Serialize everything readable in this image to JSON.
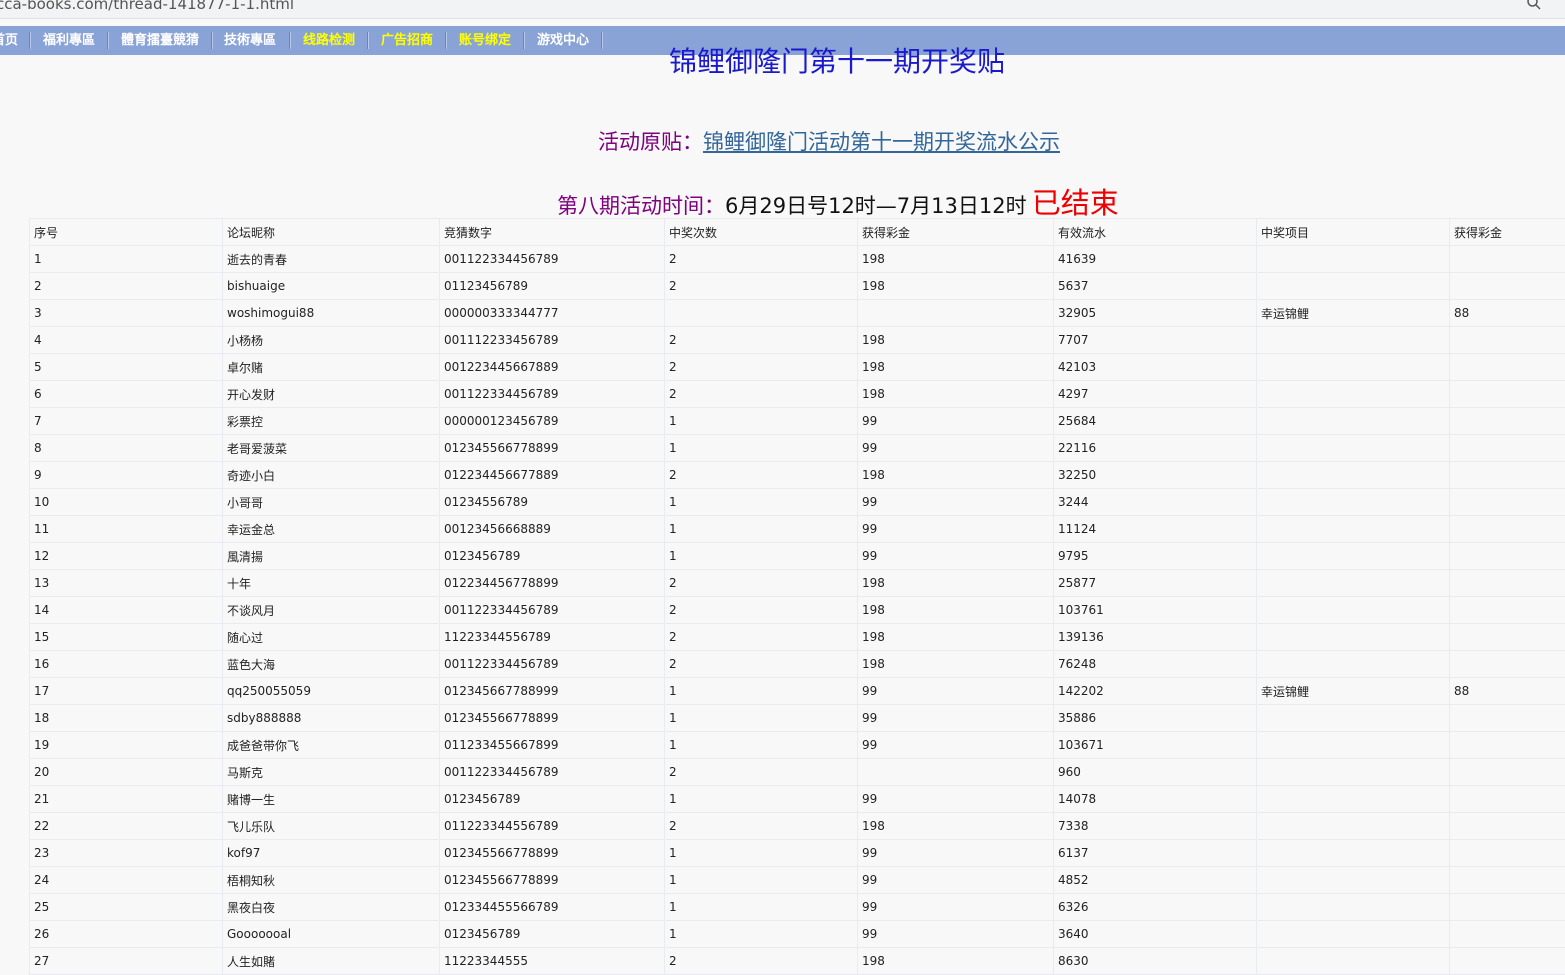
{
  "browser": {
    "url": "cca-books.com/thread-141877-1-1.html"
  },
  "nav": {
    "items": [
      {
        "label": "首页",
        "color": "#ffffff"
      },
      {
        "label": "福利專區",
        "color": "#ffffff"
      },
      {
        "label": "體育擂臺競猜",
        "color": "#ffffff"
      },
      {
        "label": "技術專區",
        "color": "#ffffff"
      },
      {
        "label": "线路检测",
        "color": "#ffff00"
      },
      {
        "label": "广告招商",
        "color": "#ffff00"
      },
      {
        "label": "账号绑定",
        "color": "#ffff00"
      },
      {
        "label": "游戏中心",
        "color": "#ffffff"
      }
    ]
  },
  "page": {
    "title": "锦鲤御隆门第十一期开奖贴",
    "original_post_label": "活动原贴：",
    "original_post_link": "锦鲤御隆门活动第十一期开奖流水公示",
    "period_label": "第八期活动时间：",
    "period_time": "6月29日号12时—7月13日12时",
    "period_status": "已结束"
  },
  "table": {
    "headers": [
      "序号",
      "论坛昵称",
      "竞猜数字",
      "中奖次数",
      "获得彩金",
      "有效流水",
      "中奖项目",
      "获得彩金"
    ],
    "rows": [
      [
        "1",
        "逝去的青春",
        "001122334456789",
        "2",
        "198",
        "41639",
        "",
        ""
      ],
      [
        "2",
        "bishuaige",
        "01123456789",
        "2",
        "198",
        "5637",
        "",
        ""
      ],
      [
        "3",
        "woshimogui88",
        "000000333344777",
        "",
        "",
        "32905",
        "幸运锦鲤",
        "88"
      ],
      [
        "4",
        "小杨杨",
        "001112233456789",
        "2",
        "198",
        "7707",
        "",
        ""
      ],
      [
        "5",
        "卓尔赌",
        "001223445667889",
        "2",
        "198",
        "42103",
        "",
        ""
      ],
      [
        "6",
        "开心发财",
        "001122334456789",
        "2",
        "198",
        "4297",
        "",
        ""
      ],
      [
        "7",
        "彩票控",
        "000000123456789",
        "1",
        "99",
        "25684",
        "",
        ""
      ],
      [
        "8",
        "老哥爱菠菜",
        "012345566778899",
        "1",
        "99",
        "22116",
        "",
        ""
      ],
      [
        "9",
        "奇迹小白",
        "012234456677889",
        "2",
        "198",
        "32250",
        "",
        ""
      ],
      [
        "10",
        "小哥哥",
        "01234556789",
        "1",
        "99",
        "3244",
        "",
        ""
      ],
      [
        "11",
        "幸运金总",
        "00123456668889",
        "1",
        "99",
        "11124",
        "",
        ""
      ],
      [
        "12",
        "風清揚",
        "0123456789",
        "1",
        "99",
        "9795",
        "",
        ""
      ],
      [
        "13",
        "十年",
        "012234456778899",
        "2",
        "198",
        "25877",
        "",
        ""
      ],
      [
        "14",
        "不谈风月",
        "001122334456789",
        "2",
        "198",
        "103761",
        "",
        ""
      ],
      [
        "15",
        "随心过",
        "11223344556789",
        "2",
        "198",
        "139136",
        "",
        ""
      ],
      [
        "16",
        "蓝色大海",
        "001122334456789",
        "2",
        "198",
        "76248",
        "",
        ""
      ],
      [
        "17",
        "qq250055059",
        "012345667788999",
        "1",
        "99",
        "142202",
        "幸运锦鲤",
        "88"
      ],
      [
        "18",
        "sdby888888",
        "012345566778899",
        "1",
        "99",
        "35886",
        "",
        ""
      ],
      [
        "19",
        "成爸爸带你飞",
        "011233455667899",
        "1",
        "99",
        "103671",
        "",
        ""
      ],
      [
        "20",
        "马斯克",
        "001122334456789",
        "2",
        "",
        "960",
        "",
        ""
      ],
      [
        "21",
        "赌博一生",
        "0123456789",
        "1",
        "99",
        "14078",
        "",
        ""
      ],
      [
        "22",
        "飞儿乐队",
        "011223344556789",
        "2",
        "198",
        "7338",
        "",
        ""
      ],
      [
        "23",
        "kof97",
        "012345566778899",
        "1",
        "99",
        "6137",
        "",
        ""
      ],
      [
        "24",
        "梧桐知秋",
        "012345566778899",
        "1",
        "99",
        "4852",
        "",
        ""
      ],
      [
        "25",
        "黑夜白夜",
        "012334455566789",
        "1",
        "99",
        "6326",
        "",
        ""
      ],
      [
        "26",
        "Gooooooal",
        "0123456789",
        "1",
        "99",
        "3640",
        "",
        ""
      ],
      [
        "27",
        "人生如賭",
        "11223344555",
        "2",
        "198",
        "8630",
        "",
        ""
      ]
    ]
  },
  "colors": {
    "nav_bg": "#8aa3d6",
    "title": "#1a1acc",
    "label_purple": "#800080",
    "link": "#336699",
    "status_red": "#ee0000"
  }
}
